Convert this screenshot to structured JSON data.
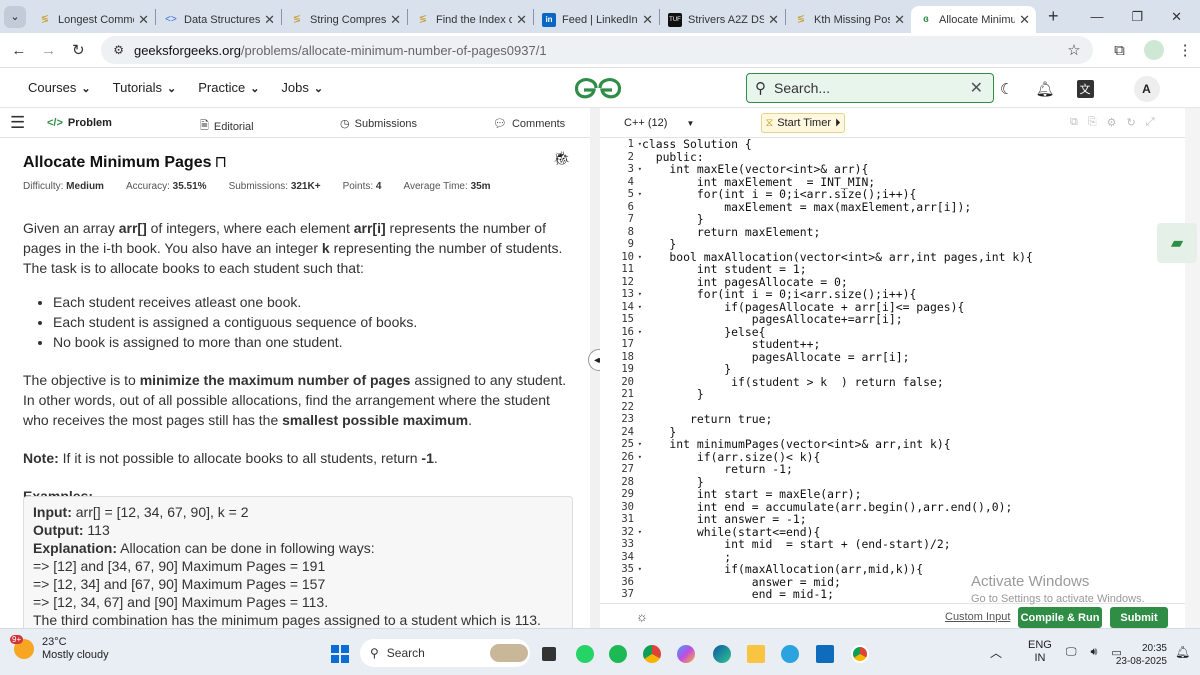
{
  "tabs": [
    {
      "title": "Longest Commo",
      "icon": "gfg"
    },
    {
      "title": "Data Structures &",
      "icon": "code"
    },
    {
      "title": "String Compress",
      "icon": "gfg"
    },
    {
      "title": "Find the Index of",
      "icon": "gfg"
    },
    {
      "title": "Feed | LinkedIn",
      "icon": "linkedin"
    },
    {
      "title": "Strivers A2Z DSA",
      "icon": "tuf"
    },
    {
      "title": "Kth Missing Posi",
      "icon": "gfg"
    },
    {
      "title": "Allocate Minimu",
      "icon": "gfg",
      "active": true
    }
  ],
  "address": {
    "site": "geeksforgeeks.org",
    "path": "/problems/allocate-minimum-number-of-pages0937/1"
  },
  "header": {
    "menu": [
      "Courses",
      "Tutorials",
      "Practice",
      "Jobs"
    ],
    "search_placeholder": "Search...",
    "avatar": "A"
  },
  "left_tabs": {
    "problem": "Problem",
    "editorial": "Editorial",
    "submissions": "Submissions",
    "comments": "Comments"
  },
  "problem": {
    "title": "Allocate Minimum Pages",
    "difficulty_label": "Difficulty:",
    "difficulty": "Medium",
    "accuracy_label": "Accuracy:",
    "accuracy": "35.51%",
    "submissions_label": "Submissions:",
    "submissions": "321K+",
    "points_label": "Points:",
    "points": "4",
    "avg_time_label": "Average Time:",
    "avg_time": "35m",
    "desc_1a": "Given an array ",
    "desc_1b": "arr[]",
    "desc_1c": " of integers, where each element ",
    "desc_1d": "arr[i]",
    "desc_1e": " represents the number of pages in the i-th book. You also have an integer ",
    "desc_1f": "k",
    "desc_1g": " representing the number of students. The task is to allocate books to each student such that:",
    "bullets": [
      "Each student receives atleast one book.",
      "Each student is assigned a contiguous sequence of books.",
      "No book is assigned to more than one student."
    ],
    "desc_2a": "The objective is to ",
    "desc_2b": "minimize the maximum number of pages",
    "desc_2c": " assigned to any student. In other words, out of all possible allocations, find the arrangement where the student who receives the most pages still has the ",
    "desc_2d": "smallest possible maximum",
    "desc_2e": ".",
    "note_label": "Note:",
    "note_text": " If it is not possible to allocate books to all students, return ",
    "note_val": "-1",
    "note_end": ".",
    "examples_label": "Examples:",
    "ex_input_label": "Input:",
    "ex_input": " arr[] = [12, 34, 67, 90], k = 2",
    "ex_output_label": "Output:",
    "ex_output": " 113",
    "ex_expl_label": "Explanation:",
    "ex_expl": " Allocation can be done in following ways:",
    "ex_lines": [
      "=> [12] and [34, 67, 90] Maximum Pages = 191",
      "=> [12, 34] and [67, 90] Maximum Pages = 157",
      "=> [12, 34, 67] and [90] Maximum Pages = 113.",
      "The third combination has the minimum pages assigned to a student which is 113."
    ]
  },
  "editor": {
    "language": "C++ (12)",
    "timer_label": "Start Timer",
    "lines": [
      "class Solution {",
      "  public:",
      "    int maxEle(vector<int>& arr){",
      "        int maxElement  = INT_MIN;",
      "        for(int i = 0;i<arr.size();i++){",
      "            maxElement = max(maxElement,arr[i]);",
      "        }",
      "        return maxElement;",
      "    }",
      "    bool maxAllocation(vector<int>& arr,int pages,int k){",
      "        int student = 1;",
      "        int pagesAllocate = 0;",
      "        for(int i = 0;i<arr.size();i++){",
      "            if(pagesAllocate + arr[i]<= pages){",
      "                pagesAllocate+=arr[i];",
      "            }else{",
      "                student++;",
      "                pagesAllocate = arr[i];",
      "            }",
      "             if(student > k  ) return false;",
      "        }",
      "",
      "       return true;",
      "    }",
      "    int minimumPages(vector<int>& arr,int k){",
      "        if(arr.size()< k){",
      "            return -1;",
      "        }",
      "        int start = maxEle(arr);",
      "        int end = accumulate(arr.begin(),arr.end(),0);",
      "        int answer = -1;",
      "        while(start<=end){",
      "            int mid  = start + (end-start)/2;",
      "            ;",
      "            if(maxAllocation(arr,mid,k)){",
      "                answer = mid;",
      "                end = mid-1;"
    ],
    "folds": [
      1,
      3,
      5,
      10,
      13,
      14,
      16,
      25,
      26,
      32,
      35
    ],
    "custom_input": "Custom Input",
    "compile_run": "Compile & Run",
    "submit": "Submit"
  },
  "watermark": {
    "line1": "Activate Windows",
    "line2": "Go to Settings to activate Windows."
  },
  "taskbar": {
    "temp": "23°C",
    "weather": "Mostly cloudy",
    "badge": "9+",
    "search": "Search",
    "lang1": "ENG",
    "lang2": "IN",
    "time": "20:35",
    "date": "23-08-2025"
  },
  "colors": {
    "gfg_green": "#2f8d46",
    "tabbar": "#d9e2ec",
    "taskbar": "#e9eef5"
  }
}
